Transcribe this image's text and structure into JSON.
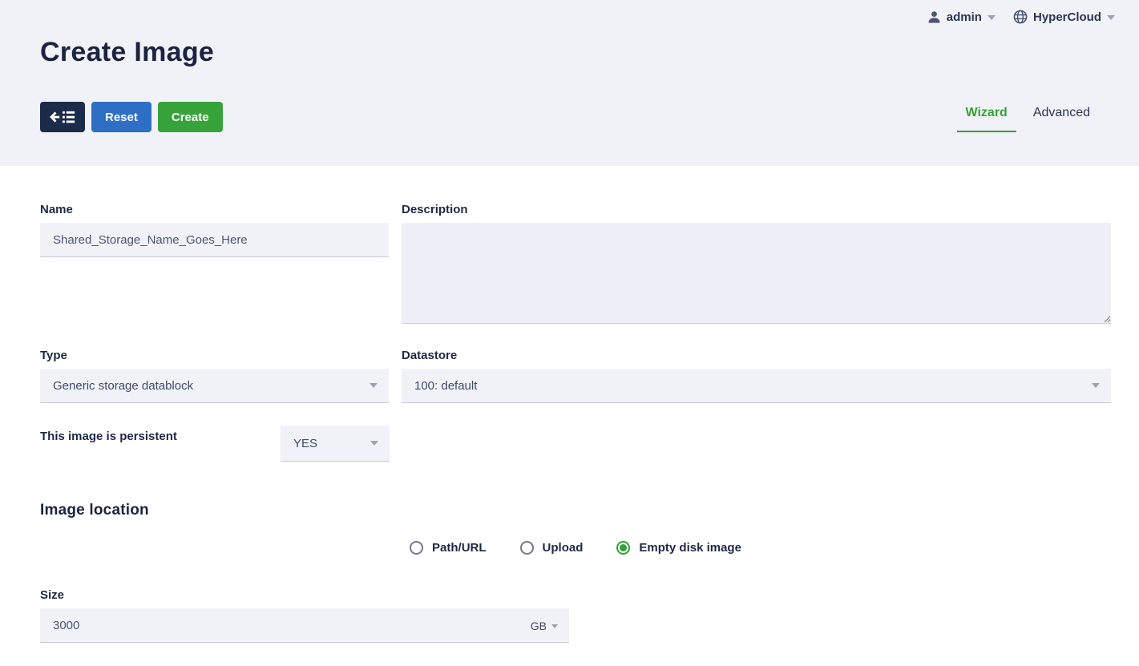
{
  "header": {
    "user_label": "admin",
    "zone_label": "HyperCloud"
  },
  "page": {
    "title": "Create Image"
  },
  "toolbar": {
    "back_icon": "back-to-list-icon",
    "reset_label": "Reset",
    "create_label": "Create"
  },
  "tabs": [
    {
      "label": "Wizard",
      "active": true
    },
    {
      "label": "Advanced",
      "active": false
    }
  ],
  "form": {
    "name": {
      "label": "Name",
      "value": "Shared_Storage_Name_Goes_Here"
    },
    "description": {
      "label": "Description",
      "value": ""
    },
    "type": {
      "label": "Type",
      "value": "Generic storage datablock"
    },
    "datastore": {
      "label": "Datastore",
      "value": "100: default"
    },
    "persistent": {
      "label": "This image is persistent",
      "value": "YES"
    },
    "image_location": {
      "heading": "Image location",
      "options": [
        {
          "label": "Path/URL",
          "selected": false
        },
        {
          "label": "Upload",
          "selected": false
        },
        {
          "label": "Empty disk image",
          "selected": true
        }
      ]
    },
    "size": {
      "label": "Size",
      "value": "3000",
      "unit": "GB"
    }
  },
  "colors": {
    "header_bg": "#f1f2f8",
    "accent_green": "#35a235",
    "button_blue": "#2d6fc5",
    "button_dark": "#1c2b4a",
    "radio_selected_green": "#2ea335",
    "input_bg": "#f0f2f8",
    "text_navy": "#1e2846"
  }
}
